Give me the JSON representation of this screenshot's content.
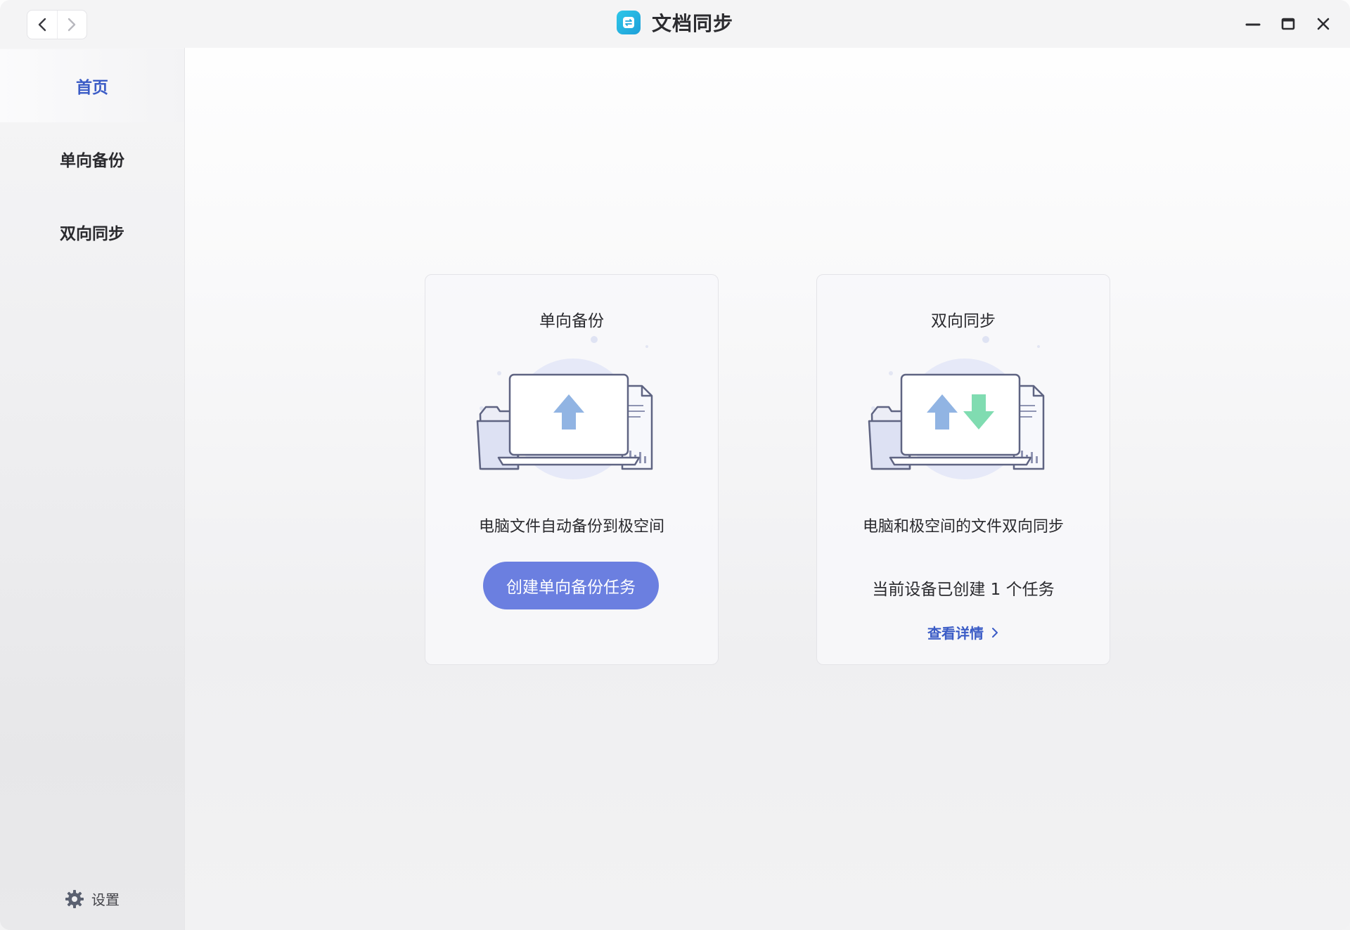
{
  "titlebar": {
    "app_title": "文档同步",
    "icons": [
      "back-icon",
      "forward-icon",
      "app-logo-icon",
      "minimize-icon",
      "maximize-icon",
      "close-icon"
    ]
  },
  "sidebar": {
    "items": [
      {
        "label": "首页",
        "active": true
      },
      {
        "label": "单向备份",
        "active": false
      },
      {
        "label": "双向同步",
        "active": false
      }
    ],
    "settings_label": "设置"
  },
  "cards": {
    "backup": {
      "title": "单向备份",
      "description": "电脑文件自动备份到极空间",
      "button_label": "创建单向备份任务"
    },
    "sync": {
      "title": "双向同步",
      "description": "电脑和极空间的文件双向同步",
      "status": "当前设备已创建 1 个任务",
      "link_label": "查看详情"
    }
  },
  "colors": {
    "accent": "#3b5cc6",
    "button": "#6b7fe0",
    "upload_arrow": "#8fb3e3",
    "download_arrow": "#7fdcb0"
  }
}
